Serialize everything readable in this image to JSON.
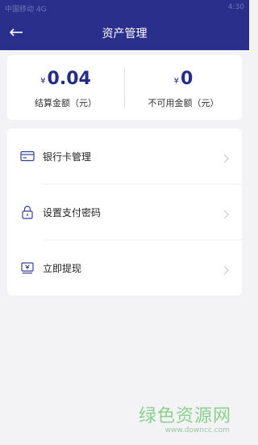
{
  "status_bar": {
    "left_text": "中国移动 4G",
    "right_text": "4:30"
  },
  "nav": {
    "title": "资产管理",
    "back_icon": "back-arrow-icon"
  },
  "balances": {
    "currency_symbol": "¥",
    "settled": {
      "amount": "0.04",
      "label": "结算金额（元）"
    },
    "unavailable": {
      "amount": "0",
      "label": "不可用金额（元）"
    }
  },
  "menu": [
    {
      "label": "银行卡管理",
      "icon": "bank-card-icon"
    },
    {
      "label": "设置支付密码",
      "icon": "lock-icon"
    },
    {
      "label": "立即提现",
      "icon": "withdraw-icon"
    }
  ],
  "watermark": {
    "text": "绿色资源网",
    "url": "www.downcc.com"
  },
  "colors": {
    "primary": "#2a2f8c",
    "accent": "#232a8a",
    "background": "#f3f3f5"
  }
}
